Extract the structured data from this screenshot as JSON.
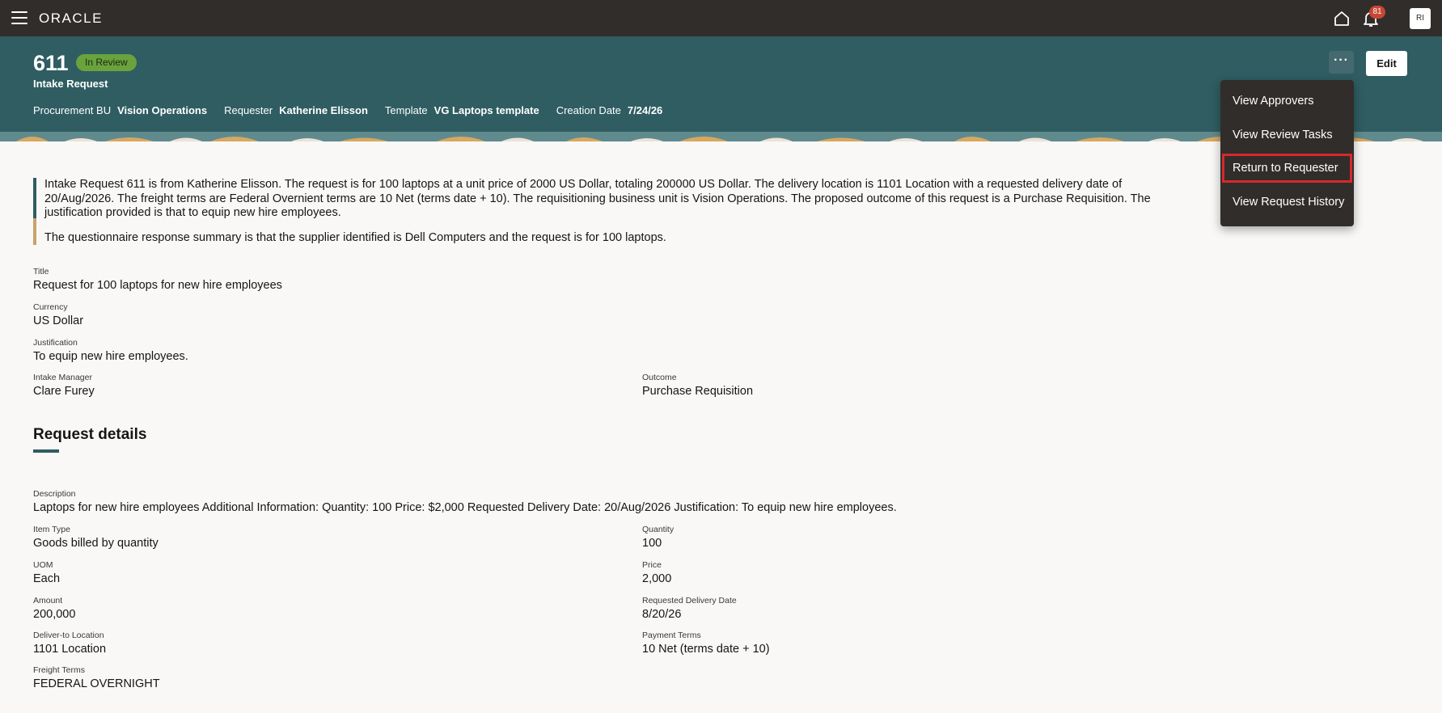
{
  "topbar": {
    "logo": "ORACLE",
    "notification_count": "81",
    "avatar_initials": "RI"
  },
  "header": {
    "number": "611",
    "status": "In Review",
    "type": "Intake Request",
    "meta": [
      {
        "label": "Procurement BU",
        "value": "Vision Operations"
      },
      {
        "label": "Requester",
        "value": "Katherine Elisson"
      },
      {
        "label": "Template",
        "value": "VG Laptops template"
      },
      {
        "label": "Creation Date",
        "value": "7/24/26"
      }
    ],
    "more_label": "···",
    "edit_label": "Edit"
  },
  "menu": {
    "items": [
      "View Approvers",
      "View Review Tasks",
      "Return to Requester",
      "View Request History"
    ],
    "highlighted": "Return to Requester"
  },
  "summary": {
    "paragraph1": "Intake Request 611 is from Katherine Elisson. The request is for 100 laptops at a unit price of 2000 US Dollar, totaling 200000 US Dollar. The delivery location is 1101 Location with a requested delivery date of 20/Aug/2026. The freight terms are Federal Overnient terms are 10 Net (terms date + 10). The requisitioning business unit is Vision Operations. The proposed outcome of this request is a Purchase Requisition. The justification provided is that to equip new hire employees.",
    "paragraph2": "The questionnaire response summary is that the supplier identified is Dell Computers and the request is for 100 laptops."
  },
  "fields": {
    "title": {
      "label": "Title",
      "value": "Request for 100 laptops for new hire employees"
    },
    "currency": {
      "label": "Currency",
      "value": "US Dollar"
    },
    "justification": {
      "label": "Justification",
      "value": "To equip new hire employees."
    },
    "intake_manager": {
      "label": "Intake Manager",
      "value": "Clare Furey"
    },
    "outcome": {
      "label": "Outcome",
      "value": "Purchase Requisition"
    }
  },
  "request_details": {
    "heading": "Request details",
    "description": {
      "label": "Description",
      "value": "Laptops for new hire employees Additional Information: Quantity: 100 Price: $2,000 Requested Delivery Date: 20/Aug/2026 Justification: To equip new hire employees."
    },
    "item_type": {
      "label": "Item Type",
      "value": "Goods billed by quantity"
    },
    "quantity": {
      "label": "Quantity",
      "value": "100"
    },
    "uom": {
      "label": "UOM",
      "value": "Each"
    },
    "price": {
      "label": "Price",
      "value": "2,000"
    },
    "amount": {
      "label": "Amount",
      "value": "200,000"
    },
    "requested_delivery_date": {
      "label": "Requested Delivery Date",
      "value": "8/20/26"
    },
    "deliver_to_location": {
      "label": "Deliver-to Location",
      "value": "1101 Location"
    },
    "payment_terms": {
      "label": "Payment Terms",
      "value": "10 Net (terms date + 10)"
    },
    "freight_terms": {
      "label": "Freight Terms",
      "value": "FEDERAL OVERNIGHT"
    }
  },
  "colors": {
    "topbar": "#312d2a",
    "header": "#2f5d62",
    "status_badge": "#6aa33d",
    "badge_red": "#c74634",
    "highlight_outline": "#d7282f"
  }
}
